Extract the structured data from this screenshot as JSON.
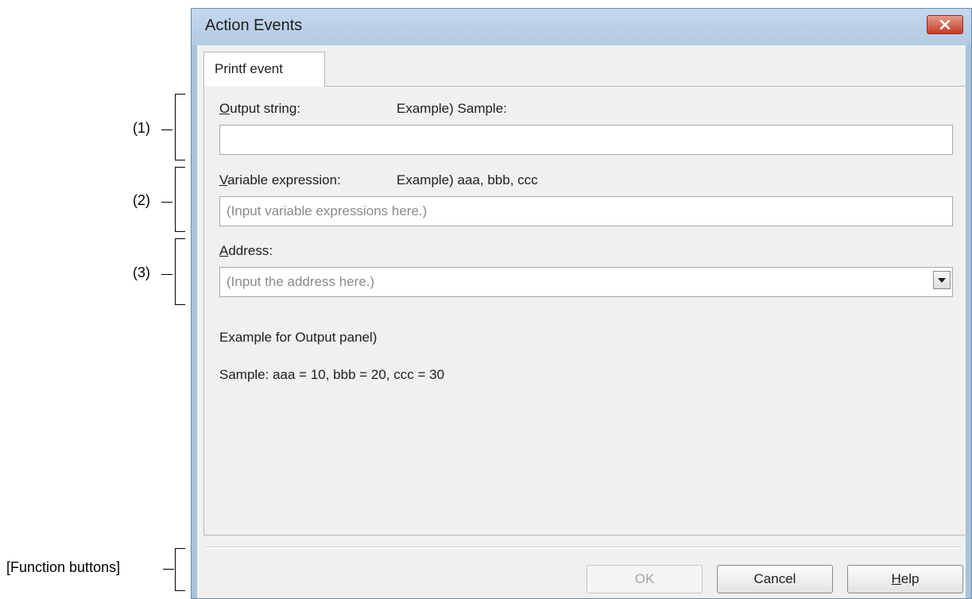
{
  "annotations": {
    "item1": "(1)",
    "item2": "(2)",
    "item3": "(3)",
    "function_buttons": "[Function buttons]"
  },
  "window": {
    "title": "Action Events",
    "close_icon": "close-x"
  },
  "tab": {
    "label": "Printf event"
  },
  "output_string": {
    "label_first": "O",
    "label_rest": "utput string:",
    "example": "Example) Sample:",
    "value": ""
  },
  "variable_expression": {
    "label_first": "V",
    "label_rest": "ariable expression:",
    "example": "Example) aaa, bbb, ccc",
    "placeholder": "(Input variable expressions here.)"
  },
  "address": {
    "label_first": "A",
    "label_rest": "ddress:",
    "placeholder": "(Input the address here.)",
    "dropdown_icon": "chevron-down"
  },
  "output_example": {
    "heading": "Example for Output panel)",
    "sample": "Sample: aaa = 10, bbb = 20, ccc = 30"
  },
  "buttons": {
    "ok": "OK",
    "cancel": "Cancel",
    "help_first": "H",
    "help_rest": "elp"
  }
}
